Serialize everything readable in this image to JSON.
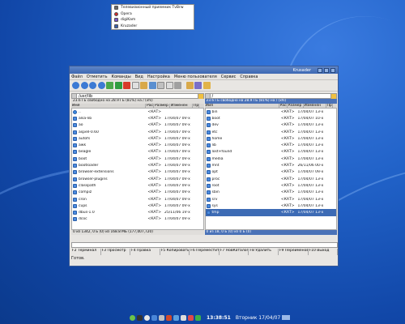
{
  "launcher": {
    "items": [
      {
        "label": "Телевизионный приемник TvBrw",
        "color": "#6a6a6a"
      },
      {
        "label": "Opera",
        "color": "#d22b2b"
      },
      {
        "label": "digiKam",
        "color": "#7a56c8"
      },
      {
        "label": "Kruzader",
        "color": "#3c5fa8"
      }
    ]
  },
  "window": {
    "title": "Krusader",
    "menu": [
      "Файл",
      "Отметить",
      "Команды",
      "Вид",
      "Настройка",
      "Меню пользователя",
      "Сервис",
      "Справка"
    ]
  },
  "left_panel": {
    "path": "/usr/lib",
    "disk_info": "23.6 ГБ свободно на 28.9 ГБ (81%) на / (xfs)",
    "columns": [
      "Имя",
      "Расш",
      "Размер",
      "Изменен",
      "Пр"
    ],
    "rows": [
      {
        "name": "..",
        "size": "<КАТ>",
        "date": "",
        "attr": "",
        "up": true
      },
      {
        "name": "alsa-lib",
        "size": "<КАТ>",
        "date": "17/04/07 09...",
        "attr": "r-x"
      },
      {
        "name": "ao",
        "size": "<КАТ>",
        "date": "17/04/07 09...",
        "attr": "r-x"
      },
      {
        "name": "aspell-0.60",
        "size": "<КАТ>",
        "date": "17/04/07 09...",
        "attr": "r-x"
      },
      {
        "name": "autofs",
        "size": "<КАТ>",
        "date": "17/04/07 09...",
        "attr": "r-x"
      },
      {
        "name": "awk",
        "size": "<КАТ>",
        "date": "17/04/07 09...",
        "attr": "r-x"
      },
      {
        "name": "beagle",
        "size": "<КАТ>",
        "date": "17/04/07 09...",
        "attr": "r-x"
      },
      {
        "name": "boot",
        "size": "<КАТ>",
        "date": "17/04/07 09...",
        "attr": "r-x"
      },
      {
        "name": "bootloader",
        "size": "<КАТ>",
        "date": "17/04/07 09...",
        "attr": "r-x"
      },
      {
        "name": "browser-extensions",
        "size": "<КАТ>",
        "date": "17/04/07 09...",
        "attr": "r-x"
      },
      {
        "name": "browser-plugins",
        "size": "<КАТ>",
        "date": "17/04/07 09...",
        "attr": "r-x"
      },
      {
        "name": "classpath",
        "size": "<КАТ>",
        "date": "17/04/07 09...",
        "attr": "r-x"
      },
      {
        "name": "compiz",
        "size": "<КАТ>",
        "date": "17/04/07 09...",
        "attr": "r-x"
      },
      {
        "name": "cron",
        "size": "<КАТ>",
        "date": "17/04/07 09...",
        "attr": "r-x"
      },
      {
        "name": "cups",
        "size": "<КАТ>",
        "date": "17/04/07 09...",
        "attr": "r-x"
      },
      {
        "name": "dbus-1.0",
        "size": "<КАТ>",
        "date": "25/11/06 19...",
        "attr": "r-x"
      },
      {
        "name": "dcoc",
        "size": "<КАТ>",
        "date": "17/04/07 09...",
        "attr": "r-x"
      }
    ],
    "status": "0 из 1342, 0 Б (0) из 168.8 МБ (177,007,720)"
  },
  "right_panel": {
    "path": "/",
    "disk_info": "23.6 ГБ свободно на 28.9 ГБ (81%) на / (xfs)",
    "columns": [
      "Имя",
      "Расш",
      "Размер",
      "Изменен",
      "Пр"
    ],
    "rows": [
      {
        "name": "bin",
        "size": "<КАТ>",
        "date": "17/04/07 13...",
        "attr": "r-x"
      },
      {
        "name": "boot",
        "size": "<КАТ>",
        "date": "17/04/07 10...",
        "attr": "r-x"
      },
      {
        "name": "dev",
        "size": "<КАТ>",
        "date": "17/04/07 13...",
        "attr": "r-x"
      },
      {
        "name": "etc",
        "size": "<КАТ>",
        "date": "17/04/07 13...",
        "attr": "r-x"
      },
      {
        "name": "home",
        "size": "<КАТ>",
        "date": "17/04/07 13...",
        "attr": "r-x"
      },
      {
        "name": "lib",
        "size": "<КАТ>",
        "date": "17/04/07 13...",
        "attr": "r-x"
      },
      {
        "name": "lost+found",
        "size": "<КАТ>",
        "date": "17/04/07 13...",
        "attr": "r-x"
      },
      {
        "name": "media",
        "size": "<КАТ>",
        "date": "17/04/07 13...",
        "attr": "r-x"
      },
      {
        "name": "mnt",
        "size": "<КАТ>",
        "date": "26/11/06 00...",
        "attr": "r-x"
      },
      {
        "name": "opt",
        "size": "<КАТ>",
        "date": "17/04/07 09...",
        "attr": "r-x"
      },
      {
        "name": "proc",
        "size": "<КАТ>",
        "date": "17/04/07 13...",
        "attr": "r-x"
      },
      {
        "name": "root",
        "size": "<КАТ>",
        "date": "17/04/07 13...",
        "attr": "r-x"
      },
      {
        "name": "sbin",
        "size": "<КАТ>",
        "date": "17/04/07 13...",
        "attr": "r-x"
      },
      {
        "name": "srv",
        "size": "<КАТ>",
        "date": "17/04/07 13...",
        "attr": "r-x"
      },
      {
        "name": "sys",
        "size": "<КАТ>",
        "date": "17/04/07 13...",
        "attr": "r-x"
      },
      {
        "name": "tmp",
        "size": "<КАТ>",
        "date": "17/04/07 13...",
        "attr": "r-x",
        "selected": true
      }
    ],
    "status": "0 из 18, 0 Б (0) из 0 Б (0)"
  },
  "fkeys": [
    "F2 Терминал",
    "F3 Просмотр",
    "F4 Правка",
    "F5 Копировать",
    "F6 Переместить",
    "F7 НовКаталог",
    "F8 Удалить",
    "F9 Переименовать",
    "F10 Выход"
  ],
  "ready": "Готов.",
  "taskbar": {
    "time": "13:38:51",
    "date": "Вторник 17/04/07"
  },
  "colors": {
    "accent": "#3d6bb5",
    "desktop": "#2162c8"
  }
}
